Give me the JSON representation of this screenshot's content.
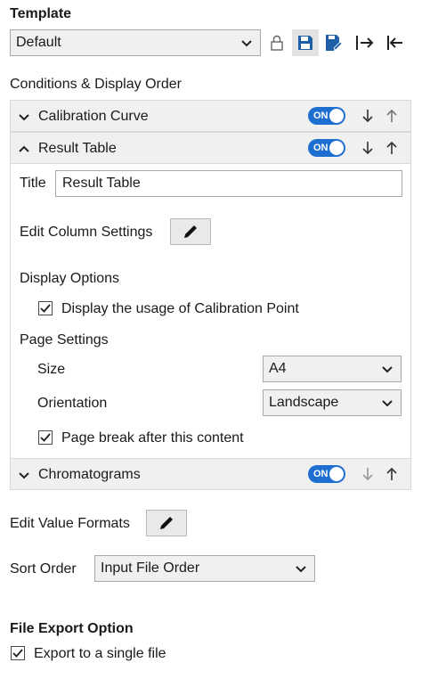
{
  "template": {
    "heading": "Template",
    "selected": "Default"
  },
  "conditions": {
    "heading": "Conditions & Display Order",
    "sections": [
      {
        "label": "Calibration Curve",
        "toggle": "ON"
      },
      {
        "label": "Result Table",
        "toggle": "ON"
      },
      {
        "label": "Chromatograms",
        "toggle": "ON"
      }
    ]
  },
  "result_table": {
    "title_label": "Title",
    "title_value": "Result Table",
    "edit_column_settings": "Edit Column Settings",
    "display_options_label": "Display Options",
    "display_usage_checkbox": "Display the usage of Calibration Point",
    "page_settings_label": "Page Settings",
    "size_label": "Size",
    "size_value": "A4",
    "orientation_label": "Orientation",
    "orientation_value": "Landscape",
    "page_break_checkbox": "Page break after this content"
  },
  "edit_value_formats": "Edit Value Formats",
  "sort_order": {
    "label": "Sort Order",
    "value": "Input File Order"
  },
  "file_export": {
    "heading": "File Export Option",
    "single_file_checkbox": "Export to a single file"
  },
  "colors": {
    "toggle_on": "#1f6fd1",
    "section_header": "#f0f0f0",
    "icon_blue": "#1f5fa8"
  }
}
